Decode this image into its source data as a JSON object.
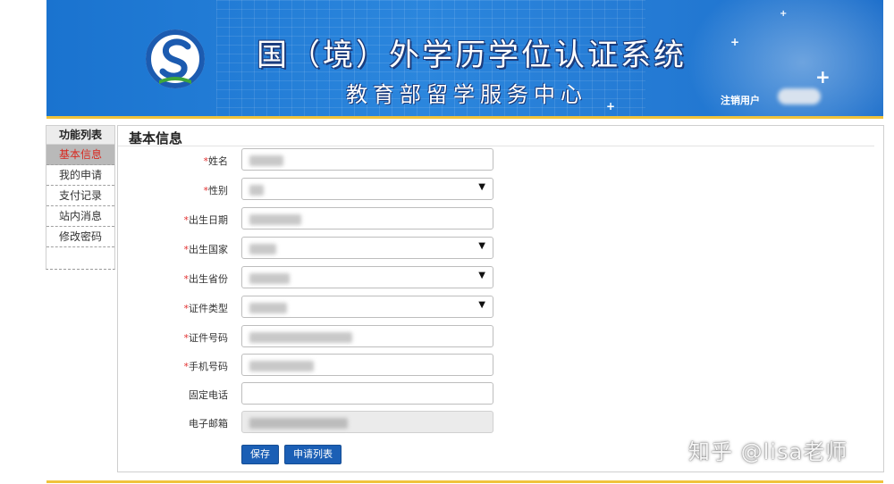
{
  "header": {
    "title": "国（境）外学历学位认证系统",
    "subtitle": "教育部留学服务中心",
    "logout": "注销用户"
  },
  "sidebar": {
    "heading": "功能列表",
    "items": [
      {
        "label": "基本信息",
        "active": true
      },
      {
        "label": "我的申请",
        "active": false
      },
      {
        "label": "支付记录",
        "active": false
      },
      {
        "label": "站内消息",
        "active": false
      },
      {
        "label": "修改密码",
        "active": false
      }
    ]
  },
  "main": {
    "section_title": "基本信息",
    "fields": [
      {
        "key": "name",
        "label": "姓名",
        "required": true,
        "type": "text"
      },
      {
        "key": "gender",
        "label": "性别",
        "required": true,
        "type": "select"
      },
      {
        "key": "birth_date",
        "label": "出生日期",
        "required": true,
        "type": "text"
      },
      {
        "key": "birth_country",
        "label": "出生国家",
        "required": true,
        "type": "select"
      },
      {
        "key": "birth_province",
        "label": "出生省份",
        "required": true,
        "type": "select"
      },
      {
        "key": "id_type",
        "label": "证件类型",
        "required": true,
        "type": "select"
      },
      {
        "key": "id_number",
        "label": "证件号码",
        "required": true,
        "type": "text"
      },
      {
        "key": "mobile",
        "label": "手机号码",
        "required": true,
        "type": "text"
      },
      {
        "key": "landline",
        "label": "固定电话",
        "required": false,
        "type": "text"
      },
      {
        "key": "email",
        "label": "电子邮箱",
        "required": false,
        "type": "readonly"
      }
    ],
    "buttons": {
      "save": "保存",
      "application_list": "申请列表"
    }
  },
  "watermark": "知乎 @lisa老师",
  "colors": {
    "banner_blue": "#1a73cf",
    "accent_gold": "#f0c33c",
    "required_red": "#e23030",
    "button_blue": "#1b5fb5",
    "active_text": "#d9281f"
  },
  "icons": {
    "logo": "cscse-logo-icon",
    "dropdown": "chevron-down-icon"
  }
}
